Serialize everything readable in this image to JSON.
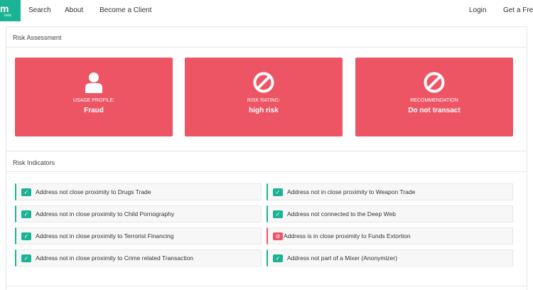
{
  "brand": {
    "logo_text": "m",
    "badge_text": "beta"
  },
  "nav": {
    "search": "Search",
    "about": "About",
    "become_client": "Become a Client",
    "login": "Login",
    "get_free": "Get a Free"
  },
  "risk_assessment": {
    "title": "Risk Assessment",
    "cards": [
      {
        "label": "USAGE PROFILE:",
        "value": "Fraud",
        "icon": "user-icon"
      },
      {
        "label": "RISK RATING:",
        "value": "high risk",
        "icon": "ban-icon"
      },
      {
        "label": "RECOMMENDATION",
        "value": "Do not transact",
        "icon": "ban-icon"
      }
    ]
  },
  "risk_indicators": {
    "title": "Risk Indicators",
    "left": [
      {
        "text": "Address not close proximity to Drugs Trade",
        "status": "ok"
      },
      {
        "text": "Address not in close proximity to Child Pornography",
        "status": "ok"
      },
      {
        "text": "Address not in close proximity to Terrorist Financing",
        "status": "ok"
      },
      {
        "text": "Address not in close proximity to Crime related Transaction",
        "status": "ok"
      }
    ],
    "right": [
      {
        "text": "Address not in close proximity to Weapon Trade",
        "status": "ok"
      },
      {
        "text": "Address not connected to the Deep Web",
        "status": "ok"
      },
      {
        "text": "Address is in close proximity to Funds Extortion",
        "status": "danger"
      },
      {
        "text": "Address not part of a Mixer (Anonymizer)",
        "status": "ok"
      }
    ]
  },
  "colors": {
    "brand": "#1bb394",
    "danger": "#ed5565",
    "check": "#1bb394"
  }
}
